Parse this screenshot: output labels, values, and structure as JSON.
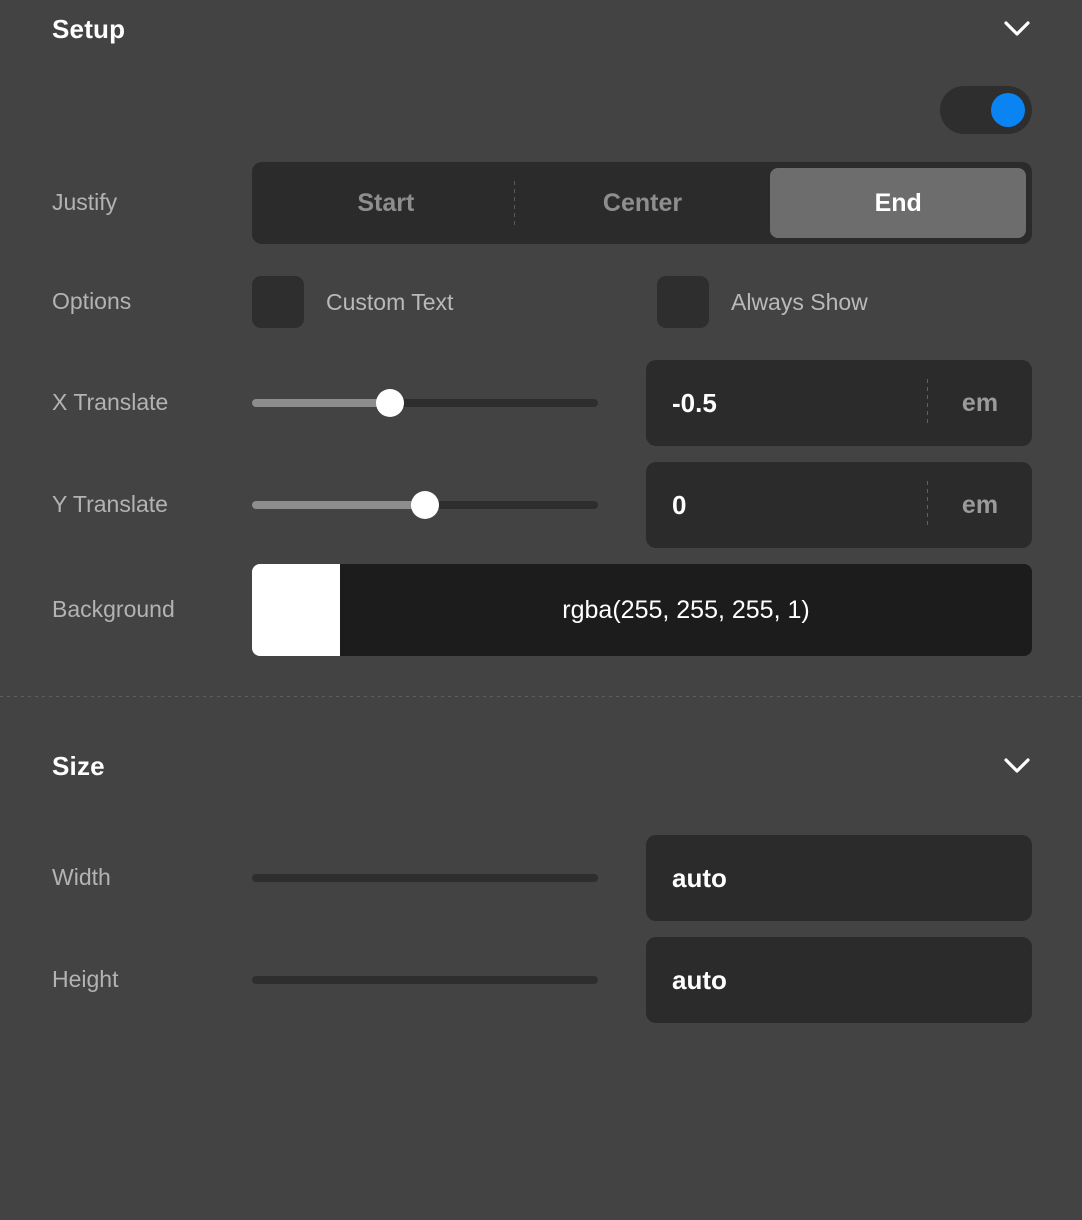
{
  "sections": [
    {
      "id": "setup",
      "title": "Setup",
      "collapse_icon": "chevron-down-icon",
      "enabled_toggle": {
        "name": "enable-toggle",
        "state": "on",
        "accent_color": "#0b84f3"
      },
      "rows": {
        "justify": {
          "label": "Justify",
          "options": [
            "Start",
            "Center",
            "End"
          ],
          "selected": "End"
        },
        "options": {
          "label": "Options",
          "checkboxes": [
            {
              "label": "Custom Text",
              "checked": false
            },
            {
              "label": "Always Show",
              "checked": false
            }
          ]
        },
        "x_translate": {
          "label": "X Translate",
          "value": "-0.5",
          "unit": "em",
          "slider_percent": 40
        },
        "y_translate": {
          "label": "Y Translate",
          "value": "0",
          "unit": "em",
          "slider_percent": 50
        },
        "background": {
          "label": "Background",
          "value": "rgba(255, 255, 255, 1)",
          "swatch_color": "#ffffff"
        }
      }
    },
    {
      "id": "size",
      "title": "Size",
      "collapse_icon": "chevron-down-icon",
      "rows": {
        "width": {
          "label": "Width",
          "value": "auto",
          "unit": "",
          "slider_percent": 0
        },
        "height": {
          "label": "Height",
          "value": "auto",
          "unit": "",
          "slider_percent": 0
        }
      }
    }
  ],
  "theme": {
    "panel_background": "#434343",
    "field_background": "#2b2b2b",
    "label_color": "#b3b3b3",
    "accent_color": "#0b84f3",
    "active_segment_color": "#6d6d6d"
  }
}
